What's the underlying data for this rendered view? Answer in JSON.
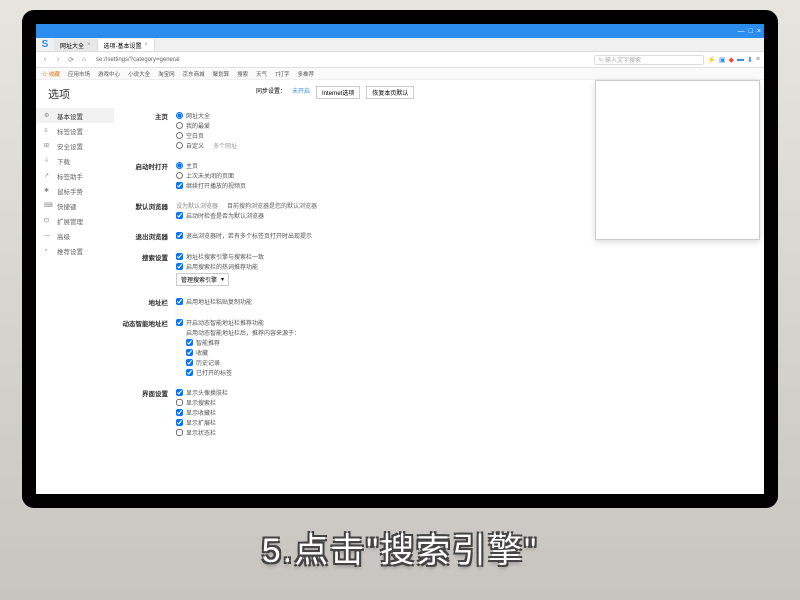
{
  "window": {
    "min": "—",
    "max": "□",
    "close": "×"
  },
  "tabs": [
    {
      "title": "网址大全",
      "active": false
    },
    {
      "title": "选项-基本设置",
      "active": true
    }
  ],
  "address": {
    "url": "se://settings/?category=general",
    "search_placeholder": "✎ 输入文字搜索"
  },
  "bookmarks": [
    "☆ 收藏",
    "应用市场",
    "游戏中心",
    "小说大全",
    "淘宝网",
    "京东商城",
    "聚划算",
    "搜索",
    "天气",
    "T打字",
    "多推荐"
  ],
  "page": {
    "title": "选项",
    "top_links": {
      "sync": "同步设置：",
      "status": "未开启",
      "btn_ie": "Internet选项",
      "btn_reset": "恢复本页默认"
    }
  },
  "sidebar": [
    {
      "icon": "⚙",
      "label": "基本设置",
      "active": true
    },
    {
      "icon": "≡",
      "label": "标签设置"
    },
    {
      "icon": "⊞",
      "label": "安全设置"
    },
    {
      "icon": "⇩",
      "label": "下载"
    },
    {
      "icon": "↗",
      "label": "标签助手"
    },
    {
      "icon": "✱",
      "label": "鼠标手势"
    },
    {
      "icon": "⌨",
      "label": "快捷键"
    },
    {
      "icon": "⊡",
      "label": "扩展管理"
    },
    {
      "icon": "—",
      "label": "高级"
    },
    {
      "icon": "◔",
      "label": "推荐设置"
    }
  ],
  "sections": {
    "homepage": {
      "label": "主页",
      "opts": [
        {
          "type": "radio",
          "text": "网址大全",
          "checked": true
        },
        {
          "type": "radio",
          "text": "我的最爱",
          "checked": false
        },
        {
          "type": "radio",
          "text": "空白页",
          "checked": false
        },
        {
          "type": "radio",
          "text": "自定义",
          "sub": "多个网址",
          "checked": false
        }
      ]
    },
    "startup": {
      "label": "启动时打开",
      "opts": [
        {
          "type": "radio",
          "text": "主页",
          "checked": true
        },
        {
          "type": "radio",
          "text": "上次未关闭的页面",
          "checked": false
        },
        {
          "type": "checkbox",
          "text": "继续打开播放的视频页",
          "checked": true
        }
      ]
    },
    "default_browser": {
      "label": "默认浏览器",
      "line1_btn": "设为默认浏览器",
      "line1_desc": "目前搜狗浏览器是您的默认浏览器",
      "opts": [
        {
          "type": "checkbox",
          "text": "启动时检查是否为默认浏览器",
          "checked": true
        }
      ]
    },
    "exit": {
      "label": "退出浏览器",
      "opts": [
        {
          "type": "checkbox",
          "text": "退出浏览器时，若有多个标签页打开时出现提示",
          "checked": true
        }
      ]
    },
    "search": {
      "label": "搜索设置",
      "opts": [
        {
          "type": "checkbox",
          "text": "地址栏搜索引擎与搜索栏一致",
          "checked": true
        },
        {
          "type": "checkbox",
          "text": "启用搜索栏的热词推荐功能",
          "checked": true
        }
      ],
      "select": "管理搜索引擎"
    },
    "addrbar": {
      "label": "地址栏",
      "opts": [
        {
          "type": "checkbox",
          "text": "启用地址栏粘贴复制功能",
          "checked": true
        }
      ]
    },
    "smart_addr": {
      "label": "动态智能地址栏",
      "opts": [
        {
          "type": "checkbox",
          "text": "开启动态智能地址栏推荐功能",
          "checked": true
        }
      ],
      "note": "启用动态智能地址栏后，推荐内容来源于：",
      "subs": [
        {
          "text": "智能推荐",
          "checked": true
        },
        {
          "text": "收藏",
          "checked": true
        },
        {
          "text": "历史记录",
          "checked": true
        },
        {
          "text": "已打开的标签",
          "checked": true
        }
      ]
    },
    "ui": {
      "label": "界面设置",
      "opts": [
        {
          "text": "显示头像换肤栏",
          "checked": true
        },
        {
          "text": "显示搜索栏",
          "checked": false
        },
        {
          "text": "显示收藏栏",
          "checked": true
        },
        {
          "text": "显示扩展栏",
          "checked": true
        },
        {
          "text": "显示状态栏",
          "checked": false
        }
      ]
    }
  },
  "caption": "5.点击\"搜索引擎\""
}
